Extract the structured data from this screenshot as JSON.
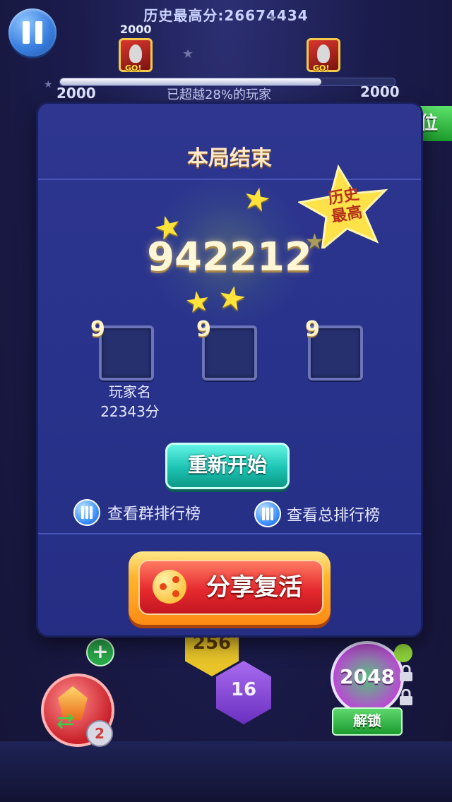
{
  "hud": {
    "best_score_label": "历史最高分:",
    "best_score_value": "26674434",
    "rank_left_score": "2000",
    "rank_left_badge": "GO!",
    "rank_right_badge": "GO!",
    "progress_left": "2000",
    "progress_right": "2000",
    "progress_percent": 78,
    "beyond_text_prefix": "已超越",
    "beyond_percent": "28%",
    "beyond_text_suffix": "的玩家",
    "corner_tab_label": "位"
  },
  "modal": {
    "title": "本局结束",
    "score": "942212",
    "best_badge": [
      "历史",
      "最高"
    ],
    "slots": [
      {
        "num": "9"
      },
      {
        "num": "9"
      },
      {
        "num": "9"
      }
    ],
    "player_name": "玩家名",
    "player_score": "22343分",
    "restart_label": "重新开始",
    "group_rank_label": "查看群排行榜",
    "total_rank_label": "查看总排行榜",
    "share_revive_label": "分享复活"
  },
  "board": {
    "hex_256": "256",
    "hex_16": "16",
    "tile_2048": "2048",
    "unlock_label": "解锁",
    "badge_count": "2",
    "plus": "+"
  },
  "colors": {
    "modal_bg": "#2e3690",
    "restart_teal": "#1cc3b2",
    "share_orange": "#ff8a14",
    "share_red": "#e62a2f",
    "star_yellow": "#ffe23a"
  }
}
